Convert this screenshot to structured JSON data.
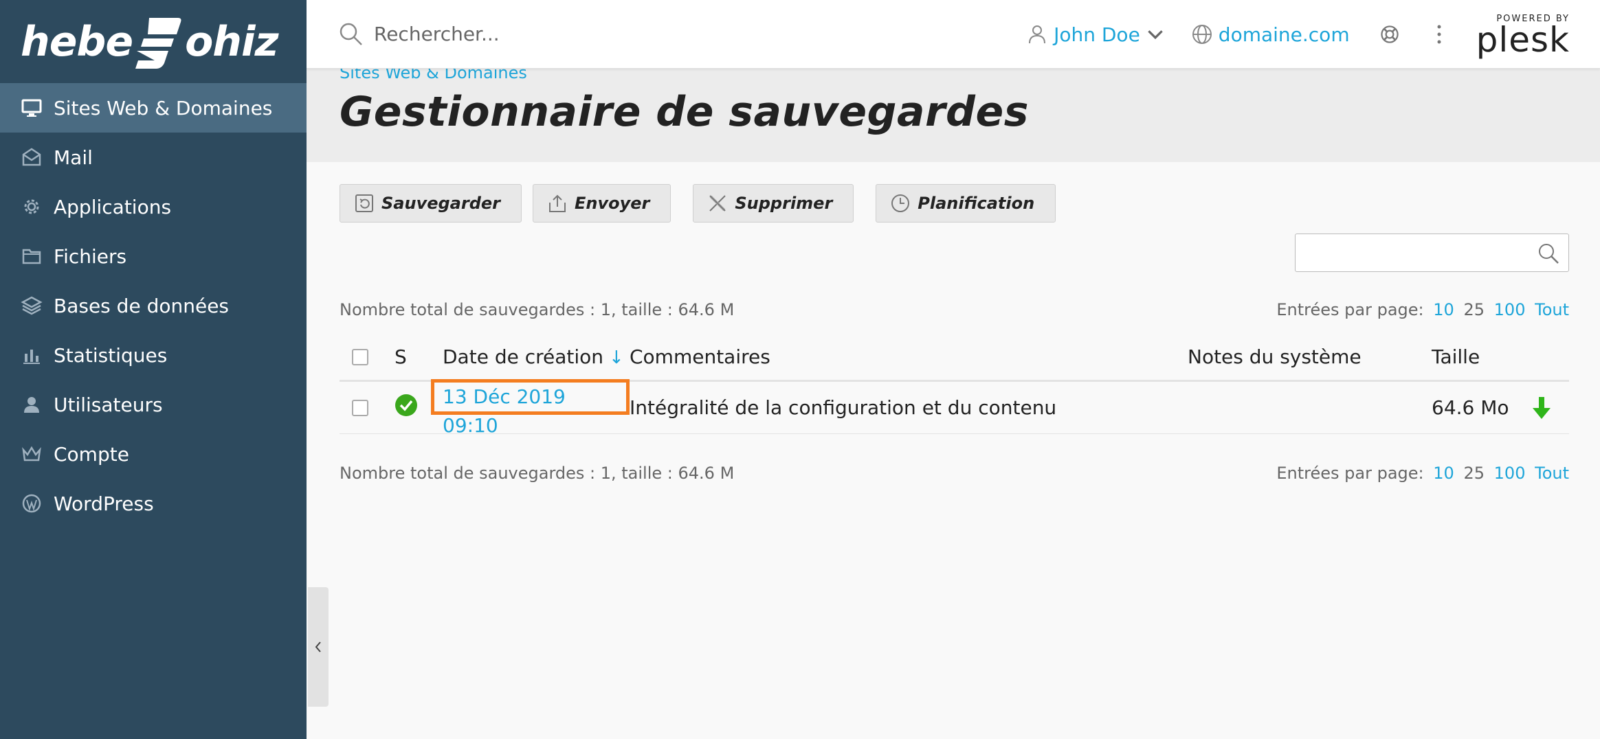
{
  "brand": {
    "logo_text_left": "hebe",
    "logo_text_right": "ohiz"
  },
  "sidebar": {
    "items": [
      {
        "label": "Sites Web & Domaines",
        "icon": "monitor-icon",
        "active": true
      },
      {
        "label": "Mail",
        "icon": "envelope-icon"
      },
      {
        "label": "Applications",
        "icon": "gear-icon"
      },
      {
        "label": "Fichiers",
        "icon": "folder-icon"
      },
      {
        "label": "Bases de données",
        "icon": "layers-icon"
      },
      {
        "label": "Statistiques",
        "icon": "bar-chart-icon"
      },
      {
        "label": "Utilisateurs",
        "icon": "user-icon"
      },
      {
        "label": "Compte",
        "icon": "crown-icon"
      },
      {
        "label": "WordPress",
        "icon": "wordpress-icon"
      }
    ]
  },
  "header": {
    "search_placeholder": "Rechercher...",
    "user": "John Doe",
    "domain": "domaine.com",
    "powered_by": "POWERED BY",
    "plesk": "plesk"
  },
  "page": {
    "breadcrumb": "Sites Web & Domaines",
    "title": "Gestionnaire de sauvegardes"
  },
  "toolbar": {
    "backup": "Sauvegarder",
    "upload": "Envoyer",
    "delete": "Supprimer",
    "schedule": "Planification"
  },
  "summary": "Nombre total de sauvegardes : 1, taille : 64.6 M",
  "per_page": {
    "label": "Entrées par page:",
    "opt10": "10",
    "opt25": "25",
    "opt100": "100",
    "all": "Tout"
  },
  "table": {
    "headers": {
      "s": "S",
      "date": "Date de création",
      "sort_arrow": "↓",
      "comments": "Commentaires",
      "notes": "Notes du système",
      "size": "Taille"
    },
    "rows": [
      {
        "date": "13 Déc 2019 09:10",
        "comment": "Intégralité de la configuration et du contenu",
        "notes": "",
        "size": "64.6 Mo",
        "status": "ok"
      }
    ]
  },
  "colors": {
    "sidebar": "#2d4a5e",
    "sidebar_active": "#4a6b82",
    "link": "#1ea5d9",
    "highlight": "#f47d20",
    "ok": "#3aa71c",
    "download": "#2fb51a"
  }
}
